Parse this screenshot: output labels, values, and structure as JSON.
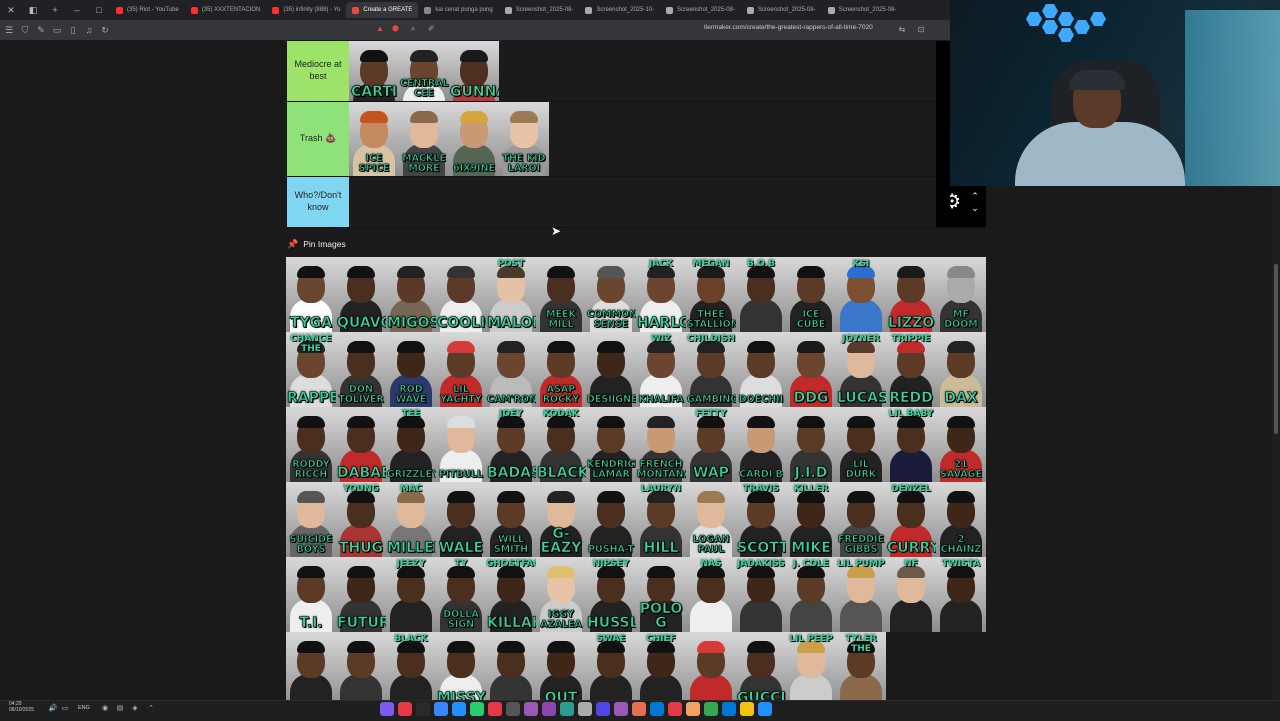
{
  "browser": {
    "tabs": [
      {
        "title": "(35) Riot - YouTube",
        "color": "#ff2d2d"
      },
      {
        "title": "(35) XXXTENTACION",
        "color": "#ff2d2d"
      },
      {
        "title": "(35) infinity (888) - Yo",
        "color": "#ff2d2d"
      },
      {
        "title": "Create a GREATE",
        "color": "#e74c3c"
      },
      {
        "title": "kai cenat punga pong",
        "color": "#888888"
      },
      {
        "title": "Screenshot_2025-08-",
        "color": "#aaaaaa"
      },
      {
        "title": "Screenshot_2025-10-",
        "color": "#aaaaaa"
      },
      {
        "title": "Screenshot_2025-08-",
        "color": "#aaaaaa"
      },
      {
        "title": "Screenshot_2025-08-",
        "color": "#aaaaaa"
      },
      {
        "title": "Screenshot_2025-08-",
        "color": "#aaaaaa"
      }
    ],
    "url": "tiermaker.com/create/the-greatest-rappers-of-all-time-7020"
  },
  "tiers": [
    {
      "label": "Mediocre at best",
      "color": "#9de36a",
      "items": [
        {
          "name": "CARTI",
          "skin": "#5b3a26",
          "shirt": "#222222",
          "hair": "#111111"
        },
        {
          "name": "CENTRAL CEE",
          "skin": "#6b4530",
          "shirt": "#eeeeee",
          "hair": "#222222"
        },
        {
          "name": "GUNNA",
          "skin": "#4d3020",
          "shirt": "#b23a3a",
          "hair": "#1a1a1a"
        }
      ]
    },
    {
      "label": "Trash 💩",
      "color": "#8fe27a",
      "items": [
        {
          "name": "ICE SPICE",
          "skin": "#c48a60",
          "shirt": "#d9c3a5",
          "hair": "#c2541c"
        },
        {
          "name": "MACKLE MORE",
          "skin": "#e0b89a",
          "shirt": "#444444",
          "hair": "#8a6a4a"
        },
        {
          "name": "6IX9INE",
          "skin": "#c99875",
          "shirt": "#556655",
          "hair": "#d6a53c"
        },
        {
          "name": "THE KID LAROI",
          "skin": "#e7c4a7",
          "shirt": "#999999",
          "hair": "#9c7a52"
        }
      ]
    },
    {
      "label": "Who?/Don't know",
      "color": "#7fd6f2",
      "items": []
    }
  ],
  "pin_header": "Pin Images",
  "pool": [
    {
      "name": "TYGA",
      "skin": "#6a4530",
      "shirt": "#ffffff",
      "hair": "#111111"
    },
    {
      "name": "QUAVO",
      "skin": "#4a2e1e",
      "shirt": "#222222",
      "hair": "#111111"
    },
    {
      "name": "MIGOS",
      "skin": "#5a3a26",
      "shirt": "#776655",
      "hair": "#222222"
    },
    {
      "name": "COOLIO",
      "skin": "#5b3a28",
      "shirt": "#eeeeee",
      "hair": "#333333"
    },
    {
      "name": "MALONE",
      "top": "POST",
      "skin": "#e3c2a6",
      "shirt": "#cccccc",
      "hair": "#4a3a2a"
    },
    {
      "name": "MEEK MILL",
      "skin": "#4a2e1e",
      "shirt": "#333333",
      "hair": "#111111"
    },
    {
      "name": "COMMON SENSE",
      "skin": "#6a4530",
      "shirt": "#dddddd",
      "hair": "#555555"
    },
    {
      "name": "HARLOW",
      "top": "JACK",
      "skin": "#6b4530",
      "shirt": "#eeeeee",
      "hair": "#222222"
    },
    {
      "name": "THEE STALLION",
      "top": "MEGAN",
      "skin": "#6b4028",
      "shirt": "#222222",
      "hair": "#1a1a1a"
    },
    {
      "name": "",
      "top": "B.O.B",
      "skin": "#4a2e1e",
      "shirt": "#333333",
      "hair": "#111111"
    },
    {
      "name": "ICE CUBE",
      "skin": "#5b3a26",
      "shirt": "#222222",
      "hair": "#111111"
    },
    {
      "name": "",
      "top": "KSI",
      "skin": "#7a5030",
      "shirt": "#3a76c9",
      "hair": "#2a6fcf"
    },
    {
      "name": "LIZZO",
      "skin": "#5b3a26",
      "shirt": "#c12a2a",
      "hair": "#1a1a1a"
    },
    {
      "name": "MF DOOM",
      "skin": "#aaaaaa",
      "shirt": "#333333",
      "hair": "#888888"
    },
    {
      "name": "RAPPER",
      "top": "CHANCE THE",
      "skin": "#6b4530",
      "shirt": "#dddddd",
      "hair": "#222222"
    },
    {
      "name": "DON TOLIVER",
      "skin": "#4a2e1e",
      "shirt": "#333333",
      "hair": "#111111"
    },
    {
      "name": "ROD WAVE",
      "skin": "#3e2618",
      "shirt": "#2a3a6a",
      "hair": "#111111"
    },
    {
      "name": "LIL YACHTY",
      "skin": "#5b3a26",
      "shirt": "#c12a2a",
      "hair": "#d63b3b"
    },
    {
      "name": "CAM'RON",
      "skin": "#6a4530",
      "shirt": "#bbbbbb",
      "hair": "#222222"
    },
    {
      "name": "ASAP ROCKY",
      "skin": "#5b3a26",
      "shirt": "#c12a2a",
      "hair": "#111111"
    },
    {
      "name": "DESIIGNER",
      "skin": "#3e2618",
      "shirt": "#222222",
      "hair": "#111111"
    },
    {
      "name": "KHALIFA",
      "top": "WIZ",
      "skin": "#6b4530",
      "shirt": "#eeeeee",
      "hair": "#222222"
    },
    {
      "name": "GAMBINO",
      "top": "CHILDISH",
      "skin": "#5b3a26",
      "shirt": "#333333",
      "hair": "#222222"
    },
    {
      "name": "DOECHII",
      "skin": "#5b3a26",
      "shirt": "#dddddd",
      "hair": "#111111"
    },
    {
      "name": "DDG",
      "skin": "#6b4530",
      "shirt": "#c12a2a",
      "hair": "#1a1a1a"
    },
    {
      "name": "LUCAS",
      "top": "JOYNER",
      "skin": "#e0b89a",
      "shirt": "#333333",
      "hair": "#5a3a2a"
    },
    {
      "name": "REDD",
      "top": "TRIPPIE",
      "skin": "#5b3a26",
      "shirt": "#222222",
      "hair": "#c12a2a"
    },
    {
      "name": "DAX",
      "skin": "#5b3a26",
      "shirt": "#ccbb99",
      "hair": "#222222"
    },
    {
      "name": "RODDY RICCH",
      "skin": "#4a2e1e",
      "shirt": "#333333",
      "hair": "#111111"
    },
    {
      "name": "DABABY",
      "skin": "#4a2e1e",
      "shirt": "#c12a2a",
      "hair": "#111111"
    },
    {
      "name": "GRIZZLEY",
      "top": "TEE",
      "skin": "#3e2618",
      "shirt": "#222222",
      "hair": "#111111"
    },
    {
      "name": "PITBULL",
      "skin": "#e0b89a",
      "shirt": "#eeeeee",
      "hair": "#dddddd"
    },
    {
      "name": "BADASS",
      "top": "JOEY",
      "skin": "#5b3a26",
      "shirt": "#222222",
      "hair": "#111111"
    },
    {
      "name": "BLACK",
      "top": "KODAK",
      "skin": "#4a2e1e",
      "shirt": "#333333",
      "hair": "#111111"
    },
    {
      "name": "KENDRICK LAMAR",
      "skin": "#5b3a26",
      "shirt": "#222222",
      "hair": "#111111"
    },
    {
      "name": "FRENCH MONTANA",
      "skin": "#c99875",
      "shirt": "#333333",
      "hair": "#222222"
    },
    {
      "name": "WAP",
      "top": "FETTY",
      "skin": "#5b3a26",
      "shirt": "#333333",
      "hair": "#111111"
    },
    {
      "name": "CARDI B",
      "skin": "#c99875",
      "shirt": "#222222",
      "hair": "#111111"
    },
    {
      "name": "J.I.D",
      "skin": "#5b3a26",
      "shirt": "#333333",
      "hair": "#111111"
    },
    {
      "name": "LIL DURK",
      "skin": "#4a2e1e",
      "shirt": "#222222",
      "hair": "#111111"
    },
    {
      "name": "",
      "top": "LIL BABY",
      "skin": "#4a2e1e",
      "shirt": "#1a1a3a",
      "hair": "#111111"
    },
    {
      "name": "21 SAVAGE",
      "skin": "#3e2618",
      "shirt": "#c12a2a",
      "hair": "#111111"
    },
    {
      "name": "SUICIDE BOYS",
      "skin": "#e0b89a",
      "shirt": "#666666",
      "hair": "#555555"
    },
    {
      "name": "THUG",
      "top": "YOUNG",
      "skin": "#4a2e1e",
      "shirt": "#aa3333",
      "hair": "#111111"
    },
    {
      "name": "MILLER",
      "top": "MAC",
      "skin": "#e0b89a",
      "shirt": "#777777",
      "hair": "#8a6a4a"
    },
    {
      "name": "WALE",
      "skin": "#4a2e1e",
      "shirt": "#222222",
      "hair": "#111111"
    },
    {
      "name": "WILL SMITH",
      "skin": "#5b3a26",
      "shirt": "#222222",
      "hair": "#111111"
    },
    {
      "name": "G-EAZY",
      "skin": "#e0b89a",
      "shirt": "#222222",
      "hair": "#222222"
    },
    {
      "name": "PUSHA-T",
      "skin": "#4a2e1e",
      "shirt": "#222222",
      "hair": "#111111"
    },
    {
      "name": "HILL",
      "top": "LAURYN",
      "skin": "#5b3a26",
      "shirt": "#333333",
      "hair": "#222222"
    },
    {
      "name": "LOGAN PAUL",
      "skin": "#e0b89a",
      "shirt": "#dddddd",
      "hair": "#9c7a52"
    },
    {
      "name": "SCOTT",
      "top": "TRAVIS",
      "skin": "#5b3a26",
      "shirt": "#222222",
      "hair": "#111111"
    },
    {
      "name": "MIKE",
      "top": "KILLER",
      "skin": "#3e2618",
      "shirt": "#222222",
      "hair": "#111111"
    },
    {
      "name": "FREDDIE GIBBS",
      "skin": "#4a2e1e",
      "shirt": "#444444",
      "hair": "#111111"
    },
    {
      "name": "CURRY",
      "top": "DENZEL",
      "skin": "#4a2e1e",
      "shirt": "#c12a2a",
      "hair": "#111111"
    },
    {
      "name": "2 CHAINZ",
      "skin": "#3e2618",
      "shirt": "#222222",
      "hair": "#111111"
    },
    {
      "name": "T.I.",
      "skin": "#5b3a26",
      "shirt": "#eeeeee",
      "hair": "#111111"
    },
    {
      "name": "FUTURE",
      "skin": "#3e2618",
      "shirt": "#333333",
      "hair": "#111111"
    },
    {
      "name": "",
      "top": "JEEZY",
      "skin": "#4a2e1e",
      "shirt": "#222222",
      "hair": "#111111"
    },
    {
      "name": "DOLLA SIGN",
      "top": "TY",
      "skin": "#4a2e1e",
      "shirt": "#333333",
      "hair": "#111111"
    },
    {
      "name": "KILLAH",
      "top": "GHOSTFACE",
      "skin": "#3e2618",
      "shirt": "#222222",
      "hair": "#111111"
    },
    {
      "name": "IGGY AZALEA",
      "skin": "#e7c4a7",
      "shirt": "#cccccc",
      "hair": "#e0c070"
    },
    {
      "name": "HUSSLE",
      "top": "NIPSEY",
      "skin": "#4a2e1e",
      "shirt": "#222222",
      "hair": "#111111"
    },
    {
      "name": "POLO G",
      "skin": "#4a2e1e",
      "shirt": "#222222",
      "hair": "#111111"
    },
    {
      "name": "",
      "top": "NAS",
      "skin": "#4a2e1e",
      "shirt": "#eeeeee",
      "hair": "#111111"
    },
    {
      "name": "",
      "top": "JADAKISS",
      "skin": "#3e2618",
      "shirt": "#333333",
      "hair": "#111111"
    },
    {
      "name": "",
      "top": "J. COLE",
      "skin": "#5b3a26",
      "shirt": "#444444",
      "hair": "#111111"
    },
    {
      "name": "",
      "top": "LIL PUMP",
      "skin": "#e0b89a",
      "shirt": "#555555",
      "hair": "#c9a04a"
    },
    {
      "name": "",
      "top": "NF",
      "skin": "#e0b89a",
      "shirt": "#222222",
      "hair": "#6a5a4a"
    },
    {
      "name": "",
      "top": "TWISTA",
      "skin": "#3e2618",
      "shirt": "#222222",
      "hair": "#111111"
    },
    {
      "name": "",
      "skin": "#5b3a26",
      "shirt": "#222222",
      "hair": "#111111"
    },
    {
      "name": "",
      "skin": "#5b3a26",
      "shirt": "#333333",
      "hair": "#111111"
    },
    {
      "name": "",
      "top": "BLACK",
      "skin": "#4a2e1e",
      "shirt": "#222222",
      "hair": "#111111"
    },
    {
      "name": "MISSY",
      "skin": "#4a2e1e",
      "shirt": "#eeeeee",
      "hair": "#111111"
    },
    {
      "name": "",
      "skin": "#4a2e1e",
      "shirt": "#333333",
      "hair": "#111111"
    },
    {
      "name": "OUT",
      "skin": "#3e2618",
      "shirt": "#222222",
      "hair": "#111111"
    },
    {
      "name": "",
      "top": "SWAE",
      "skin": "#4a2e1e",
      "shirt": "#222222",
      "hair": "#111111"
    },
    {
      "name": "",
      "top": "CHIEF",
      "skin": "#3e2618",
      "shirt": "#222222",
      "hair": "#111111"
    },
    {
      "name": "",
      "skin": "#5b3a26",
      "shirt": "#c12a2a",
      "hair": "#d63b3b"
    },
    {
      "name": "GUCCI",
      "skin": "#4a2e1e",
      "shirt": "#333333",
      "hair": "#111111"
    },
    {
      "name": "",
      "top": "LIL PEEP",
      "skin": "#e0b89a",
      "shirt": "#cccccc",
      "hair": "#c9a04a"
    },
    {
      "name": "",
      "top": "TYLER THE",
      "skin": "#5b3a26",
      "shirt": "#8a6a4a",
      "hair": "#111111"
    }
  ],
  "taskbar": {
    "time": "04:29",
    "date": "06/10/2025",
    "lang": "ENG"
  },
  "colors": {
    "tile_name": "#36d39c",
    "page_bg": "#1a1a1a"
  }
}
